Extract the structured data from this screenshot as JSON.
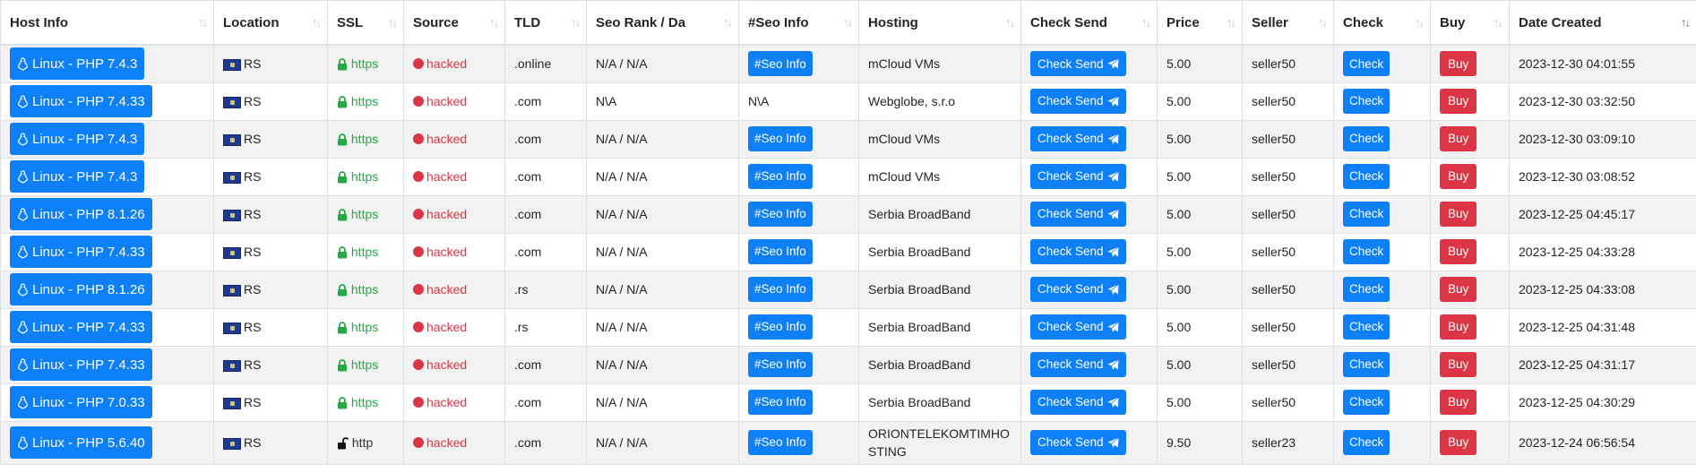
{
  "table": {
    "columns": [
      {
        "label": "Host Info",
        "sort": "both"
      },
      {
        "label": "Location",
        "sort": "both"
      },
      {
        "label": "SSL",
        "sort": "both"
      },
      {
        "label": "Source",
        "sort": "both"
      },
      {
        "label": "TLD",
        "sort": "both"
      },
      {
        "label": "Seo Rank / Da",
        "sort": "both"
      },
      {
        "label": "#Seo Info",
        "sort": "both"
      },
      {
        "label": "Hosting",
        "sort": "both"
      },
      {
        "label": "Check Send",
        "sort": "both"
      },
      {
        "label": "Price",
        "sort": "both"
      },
      {
        "label": "Seller",
        "sort": "both"
      },
      {
        "label": "Check",
        "sort": "both"
      },
      {
        "label": "Buy",
        "sort": "both"
      },
      {
        "label": "Date Created",
        "sort": "desc"
      }
    ],
    "check_send_label": "Check Send",
    "check_label": "Check",
    "buy_label": "Buy",
    "rows": [
      {
        "host": "Linux - PHP 7.4.3",
        "location": "RS",
        "ssl": "https",
        "source": "hacked",
        "tld": ".online",
        "seo_rank": "N/A / N/A",
        "seo_info": "#Seo Info",
        "hosting": "mCloud VMs",
        "price": "5.00",
        "seller": "seller50",
        "date": "2023-12-30 04:01:55"
      },
      {
        "host": "Linux - PHP 7.4.33",
        "location": "RS",
        "ssl": "https",
        "source": "hacked",
        "tld": ".com",
        "seo_rank": "N\\A",
        "seo_info": "N\\A",
        "hosting": "Webglobe, s.r.o",
        "price": "5.00",
        "seller": "seller50",
        "date": "2023-12-30 03:32:50"
      },
      {
        "host": "Linux - PHP 7.4.3",
        "location": "RS",
        "ssl": "https",
        "source": "hacked",
        "tld": ".com",
        "seo_rank": "N/A / N/A",
        "seo_info": "#Seo Info",
        "hosting": "mCloud VMs",
        "price": "5.00",
        "seller": "seller50",
        "date": "2023-12-30 03:09:10"
      },
      {
        "host": "Linux - PHP 7.4.3",
        "location": "RS",
        "ssl": "https",
        "source": "hacked",
        "tld": ".com",
        "seo_rank": "N/A / N/A",
        "seo_info": "#Seo Info",
        "hosting": "mCloud VMs",
        "price": "5.00",
        "seller": "seller50",
        "date": "2023-12-30 03:08:52"
      },
      {
        "host": "Linux - PHP 8.1.26",
        "location": "RS",
        "ssl": "https",
        "source": "hacked",
        "tld": ".com",
        "seo_rank": "N/A / N/A",
        "seo_info": "#Seo Info",
        "hosting": "Serbia BroadBand",
        "price": "5.00",
        "seller": "seller50",
        "date": "2023-12-25 04:45:17"
      },
      {
        "host": "Linux - PHP 7.4.33",
        "location": "RS",
        "ssl": "https",
        "source": "hacked",
        "tld": ".com",
        "seo_rank": "N/A / N/A",
        "seo_info": "#Seo Info",
        "hosting": "Serbia BroadBand",
        "price": "5.00",
        "seller": "seller50",
        "date": "2023-12-25 04:33:28"
      },
      {
        "host": "Linux - PHP 8.1.26",
        "location": "RS",
        "ssl": "https",
        "source": "hacked",
        "tld": ".rs",
        "seo_rank": "N/A / N/A",
        "seo_info": "#Seo Info",
        "hosting": "Serbia BroadBand",
        "price": "5.00",
        "seller": "seller50",
        "date": "2023-12-25 04:33:08"
      },
      {
        "host": "Linux - PHP 7.4.33",
        "location": "RS",
        "ssl": "https",
        "source": "hacked",
        "tld": ".rs",
        "seo_rank": "N/A / N/A",
        "seo_info": "#Seo Info",
        "hosting": "Serbia BroadBand",
        "price": "5.00",
        "seller": "seller50",
        "date": "2023-12-25 04:31:48"
      },
      {
        "host": "Linux - PHP 7.4.33",
        "location": "RS",
        "ssl": "https",
        "source": "hacked",
        "tld": ".com",
        "seo_rank": "N/A / N/A",
        "seo_info": "#Seo Info",
        "hosting": "Serbia BroadBand",
        "price": "5.00",
        "seller": "seller50",
        "date": "2023-12-25 04:31:17"
      },
      {
        "host": "Linux - PHP 7.0.33",
        "location": "RS",
        "ssl": "https",
        "source": "hacked",
        "tld": ".com",
        "seo_rank": "N/A / N/A",
        "seo_info": "#Seo Info",
        "hosting": "Serbia BroadBand",
        "price": "5.00",
        "seller": "seller50",
        "date": "2023-12-25 04:30:29"
      },
      {
        "host": "Linux - PHP 5.6.40",
        "location": "RS",
        "ssl": "http",
        "source": "hacked",
        "tld": ".com",
        "seo_rank": "N/A / N/A",
        "seo_info": "#Seo Info",
        "hosting": "ORIONTELEKOMTIMHOSTING",
        "price": "9.50",
        "seller": "seller23",
        "date": "2023-12-24 06:56:54"
      }
    ]
  },
  "icons": {
    "host": "linux-icon",
    "flag": "flag-icon",
    "ssl_secure": "lock-icon",
    "ssl_insecure": "unlock-icon",
    "source": "red-dot-icon",
    "send": "paper-plane-icon",
    "sort": "sort-arrows-icon"
  },
  "colors": {
    "primary": "#0d7ff7",
    "danger": "#dc3545",
    "success": "#28a745",
    "stripe": "#f2f2f2",
    "border": "#dee2e6"
  }
}
